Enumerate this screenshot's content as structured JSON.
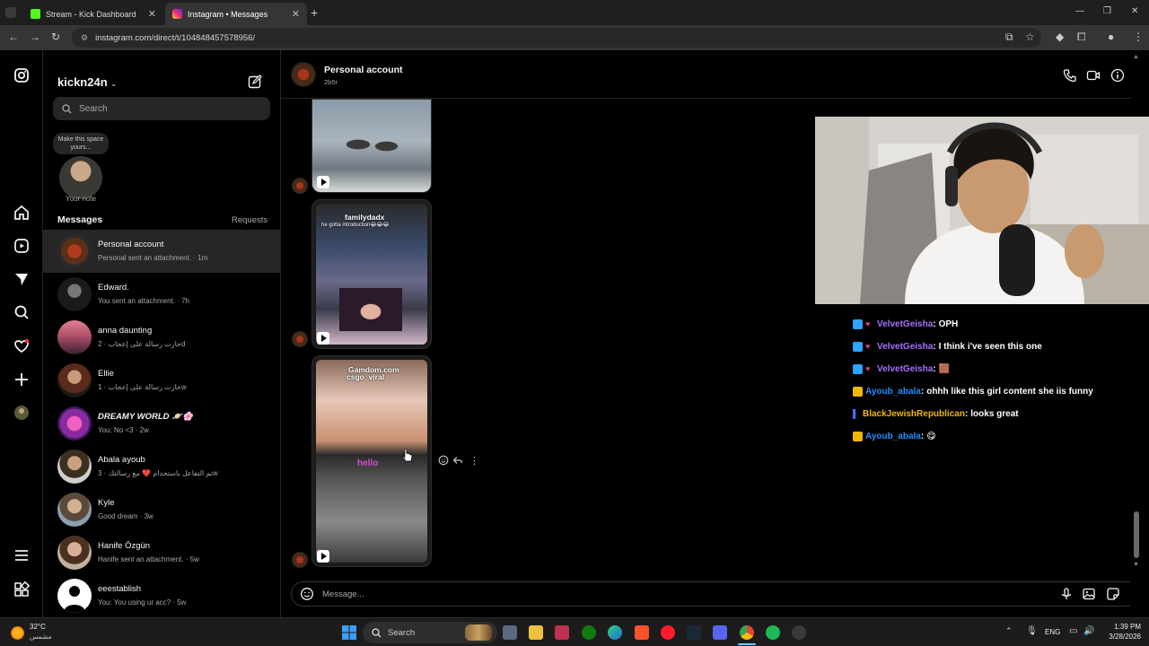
{
  "browser": {
    "tabs": [
      {
        "title": "Stream - Kick Dashboard",
        "icon": "kick-icon",
        "active": false
      },
      {
        "title": "Instagram • Messages",
        "icon": "instagram-icon",
        "active": true
      }
    ],
    "url": "instagram.com/direct/t/104848457578956/"
  },
  "inbox": {
    "username": "kickn24n",
    "search_placeholder": "Search",
    "note_bubble": "Make this space yours...",
    "note_label": "Your note",
    "messages_heading": "Messages",
    "requests_label": "Requests",
    "conversations": [
      {
        "name": "Personal account",
        "preview": "Personal sent an attachment. · 1m",
        "active": true
      },
      {
        "name": "Edward.",
        "preview": "You sent an attachment. · 7h",
        "active": false
      },
      {
        "name": "anna daunting",
        "preview": "حازت رسالة على إعجاب · 2d",
        "active": false
      },
      {
        "name": "Ellie",
        "preview": "حازت رسالة على إعجاب · 1w",
        "active": false
      },
      {
        "name": "DREAMY WORLD 🪐🌸",
        "preview": "You: No <3 · 2w",
        "active": false
      },
      {
        "name": "Abala ayoub",
        "preview": "تم التفاعل باستخدام ❤️ مع رسالتك · 3w",
        "active": false
      },
      {
        "name": "Kyle",
        "preview": "Good dream · 3w",
        "active": false
      },
      {
        "name": "Hanife Özgün",
        "preview": "Hanife sent an attachment. · 5w",
        "active": false
      },
      {
        "name": "eeestablish",
        "preview": "You: You using ur acc? · 5w",
        "active": false
      }
    ]
  },
  "chat": {
    "name": "Personal account",
    "sub": "2b5r",
    "media": [
      {
        "caption_user": "",
        "caption_text": ""
      },
      {
        "caption_user": "familydadx",
        "caption_text": "he gotta introduction😂😂😂"
      },
      {
        "caption_user": "csgo_viral",
        "caption_text": "Gamdom.com"
      }
    ],
    "overlay_text": "hello",
    "input_placeholder": "Message..."
  },
  "stream_chat": [
    {
      "user": "VelvetGeisha",
      "msg": "OPH",
      "color": "#a970ff",
      "badges": 2
    },
    {
      "user": "VelvetGeisha",
      "msg": "I think i've seen this one",
      "color": "#a970ff",
      "badges": 2
    },
    {
      "user": "VelvetGeisha",
      "msg": "🟫",
      "color": "#a970ff",
      "badges": 2
    },
    {
      "user": "Ayoub_abala",
      "msg": "ohhh like this girl content she iis funny",
      "color": "#1e90ff",
      "badges": 1
    },
    {
      "user": "BlackJewishRepublican",
      "msg": "looks great",
      "color": "#f2b705",
      "badges": 1
    },
    {
      "user": "Ayoub_abala",
      "msg": "😋",
      "color": "#1e90ff",
      "badges": 1
    }
  ],
  "taskbar": {
    "weather_temp": "32°C",
    "weather_desc": "مشمس",
    "search_label": "Search",
    "lang": "ENG",
    "time": "1:39 PM",
    "date": "3/28/2026"
  },
  "colors": {
    "accent": "#0095f6",
    "panel": "#262626",
    "muted": "#a8a8a8"
  }
}
